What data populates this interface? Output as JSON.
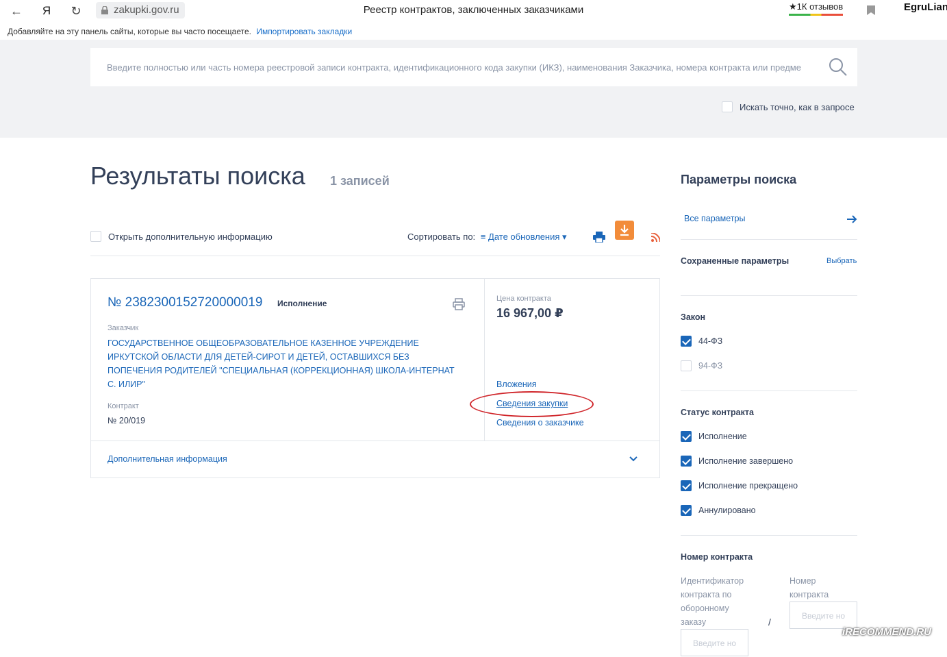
{
  "browser": {
    "url": "zakupki.gov.ru",
    "tab_title": "Реестр контрактов, заключенных заказчиками",
    "reviews": "1К отзывов",
    "user": "EgruLian",
    "bookmarks_hint": "Добавляйте на эту панель сайты, которые вы часто посещаете.",
    "bookmarks_link": "Импортировать закладки"
  },
  "search": {
    "placeholder": "Введите полностью или часть номера реестровой записи контракта, идентификационного кода закупки (ИКЗ), наименования Заказчика, номера контракта или предме",
    "exact_label": "Искать точно, как в запросе"
  },
  "results": {
    "title": "Результаты поиска",
    "count": "1 записей",
    "open_info": "Открыть дополнительную информацию",
    "sort_label": "Сортировать по:",
    "sort_value": "Дате обновления"
  },
  "card": {
    "number": "№ 2382300152720000019",
    "status": "Исполнение",
    "customer_label": "Заказчик",
    "customer_name": "ГОСУДАРСТВЕННОЕ ОБЩЕОБРАЗОВАТЕЛЬНОЕ КАЗЕННОЕ УЧРЕЖДЕНИЕ ИРКУТСКОЙ ОБЛАСТИ ДЛЯ ДЕТЕЙ-СИРОТ И ДЕТЕЙ, ОСТАВШИХСЯ БЕЗ ПОПЕЧЕНИЯ РОДИТЕЛЕЙ \"СПЕЦИАЛЬНАЯ (КОРРЕКЦИОННАЯ) ШКОЛА-ИНТЕРНАТ С. ИЛИР\"",
    "contract_label": "Контракт",
    "contract_no": "№ 20/019",
    "price_label": "Цена контракта",
    "price": "16 967,00 ₽",
    "link_attachments": "Вложения",
    "link_purchase": "Сведения закупки",
    "link_customer": "Сведения о заказчике",
    "extra_info": "Дополнительная информация"
  },
  "sidebar": {
    "title": "Параметры поиска",
    "all_params": "Все параметры",
    "saved_params": "Сохраненные параметры",
    "choose": "Выбрать",
    "law_title": "Закон",
    "laws": [
      {
        "label": "44-ФЗ",
        "checked": true
      },
      {
        "label": "94-ФЗ",
        "checked": false
      }
    ],
    "status_title": "Статус контракта",
    "statuses": [
      {
        "label": "Исполнение",
        "checked": true
      },
      {
        "label": "Исполнение завершено",
        "checked": true
      },
      {
        "label": "Исполнение прекращено",
        "checked": true
      },
      {
        "label": "Аннулировано",
        "checked": true
      }
    ],
    "contract_no_title": "Номер контракта",
    "defense_id_label": "Идентификатор контракта по оборонному заказу",
    "number_label": "Номер контракта",
    "input_placeholder": "Введите но",
    "separator": "/"
  },
  "watermark": "iRECOMMEND.RU",
  "colors": {
    "accent": "#1a66b8",
    "download": "#f28c3a",
    "highlight": "#d0262b"
  }
}
